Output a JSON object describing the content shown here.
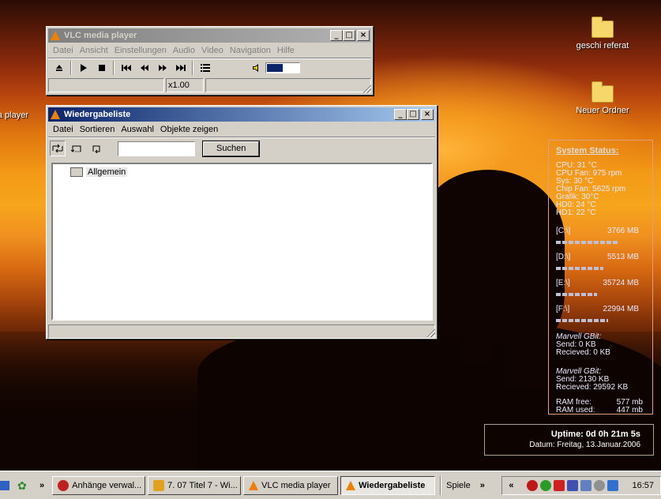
{
  "desktop": {
    "icons": [
      {
        "label": "geschi referat"
      },
      {
        "label": "Neuer Ordner"
      },
      {
        "label": "a player"
      }
    ]
  },
  "vlc_main": {
    "title": "VLC media player",
    "menu": [
      "Datei",
      "Ansicht",
      "Einstellungen",
      "Audio",
      "Video",
      "Navigation",
      "Hilfe"
    ],
    "speed": "x1.00",
    "volume_fraction": 0.5
  },
  "playlist": {
    "title": "Wiedergabeliste",
    "menu": [
      "Datei",
      "Sortieren",
      "Auswahl",
      "Objekte zeigen"
    ],
    "search_value": "",
    "search_button": "Suchen",
    "tree_item": "Allgemein"
  },
  "system_status": {
    "header": "System Status:",
    "lines": [
      "CPU: 31 °C",
      "CPU Fan: 975 rpm",
      "Sys: 30 °C",
      "Chip Fan: 5625 rpm",
      "Grafik: 30°C",
      "HD0: 24 °C",
      "HD1: 22 °C"
    ],
    "drives": [
      {
        "name": "[C:\\]",
        "size": "3766 MB"
      },
      {
        "name": "[D:\\]",
        "size": "5513 MB"
      },
      {
        "name": "[E:\\]",
        "size": "35724 MB"
      },
      {
        "name": "[F:\\]",
        "size": "22994 MB"
      }
    ],
    "net1_title": "Marvell GBit:",
    "net1_send": "Send: 0 KB",
    "net1_recv": "Recieved: 0 KB",
    "net2_title": "Marvell GBit:",
    "net2_send": "Send: 2130 KB",
    "net2_recv": "Recieved: 29592 KB",
    "ram_free_label": "RAM free:",
    "ram_free": "577 mb",
    "ram_used_label": "RAM used:",
    "ram_used": "447 mb"
  },
  "uptime": {
    "line1": "Uptime: 0d 0h 21m 5s",
    "line2": "Datum: Freitag, 13.Januar.2006"
  },
  "taskbar": {
    "chevron": "»",
    "tasks": [
      {
        "label": "Anhänge verwal..."
      },
      {
        "label": "7. 07 Titel 7 - Wi..."
      },
      {
        "label": "VLC media player"
      },
      {
        "label": "Wiedergabeliste"
      }
    ],
    "games": "Spiele",
    "tray_chevron": "«",
    "clock": "16:57"
  }
}
